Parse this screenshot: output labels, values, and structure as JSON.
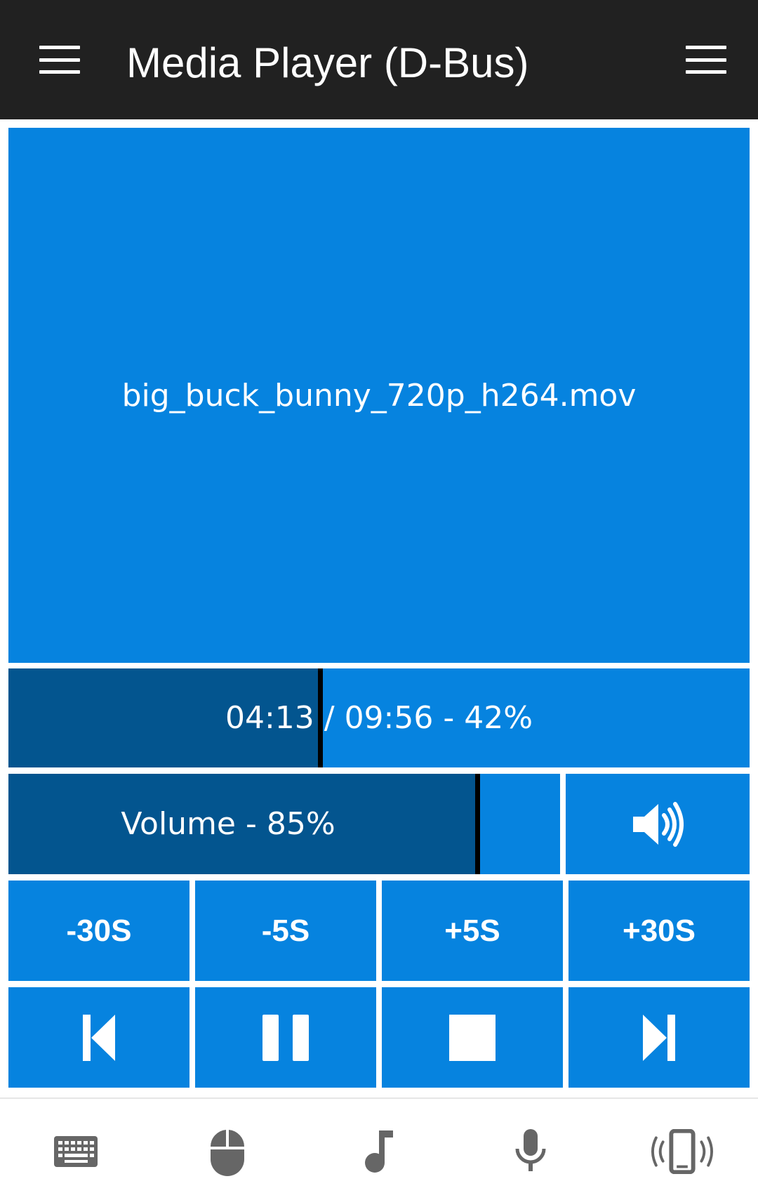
{
  "app": {
    "title": "Media Player (D-Bus)"
  },
  "topbar": {
    "left_icon": "hamburger-menu-icon",
    "right_icon": "hamburger-menu-icon"
  },
  "media": {
    "filename": "big_buck_bunny_720p_h264.mov"
  },
  "progress": {
    "label": "04:13 / 09:56 - 42%",
    "percent": 42
  },
  "volume": {
    "label": "Volume - 85%",
    "percent": 85,
    "mute_icon": "volume-up-icon"
  },
  "seek_buttons": [
    {
      "label": "-30S"
    },
    {
      "label": "-5S"
    },
    {
      "label": "+5S"
    },
    {
      "label": "+30S"
    }
  ],
  "transport_buttons": [
    {
      "icon": "skip-previous-icon"
    },
    {
      "icon": "pause-icon"
    },
    {
      "icon": "stop-icon"
    },
    {
      "icon": "skip-next-icon"
    }
  ],
  "bottom_nav": [
    {
      "icon": "keyboard-icon"
    },
    {
      "icon": "mouse-icon"
    },
    {
      "icon": "music-note-icon"
    },
    {
      "icon": "microphone-icon"
    },
    {
      "icon": "phone-vibrate-icon"
    }
  ],
  "colors": {
    "topbar": "#212121",
    "tile": "#0683df",
    "fill": "#03558f",
    "bottom_icon": "#666666"
  }
}
